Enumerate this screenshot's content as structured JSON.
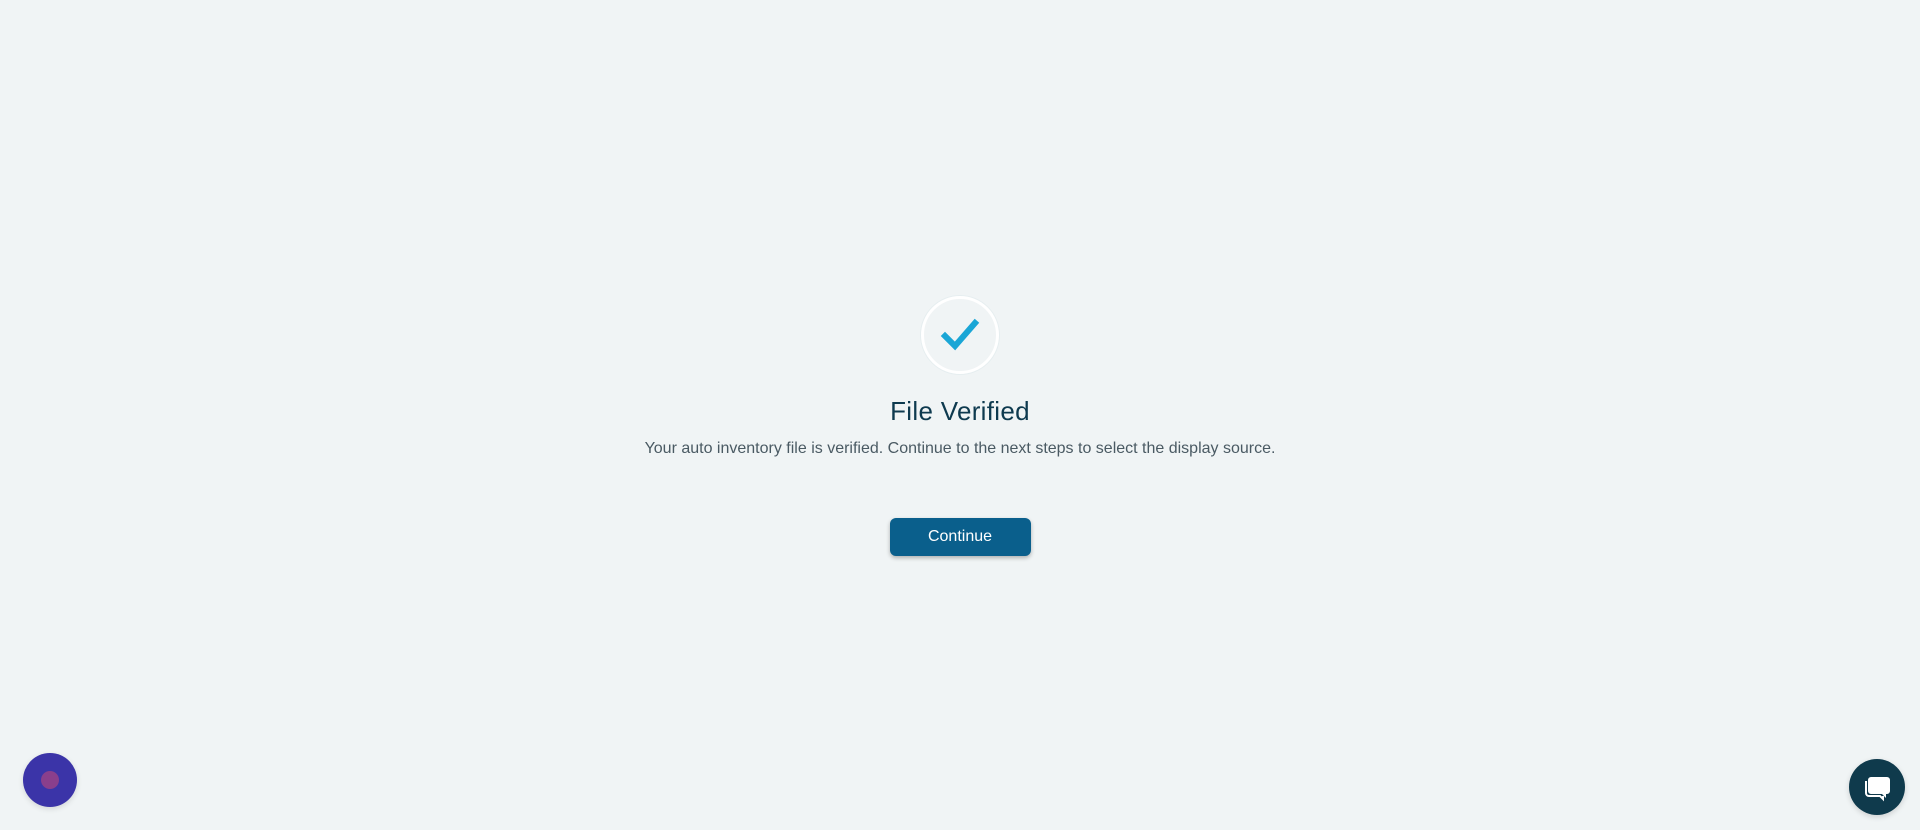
{
  "status": {
    "icon": "check-mark-icon",
    "title": "File Verified",
    "message": "Your auto inventory file is verified. Continue to the next steps to select the display source."
  },
  "actions": {
    "continue_label": "Continue"
  },
  "widgets": {
    "assistant_icon": "assistant-bubble-icon",
    "chat_icon": "chat-bubbles-icon"
  },
  "colors": {
    "background": "#f0f4f5",
    "accent_check": "#1aa6d6",
    "primary_button": "#0a5f8c",
    "title_text": "#0e3a4f",
    "assistant_bubble": "#3b34a8",
    "chat_button": "#0f3a4c"
  }
}
